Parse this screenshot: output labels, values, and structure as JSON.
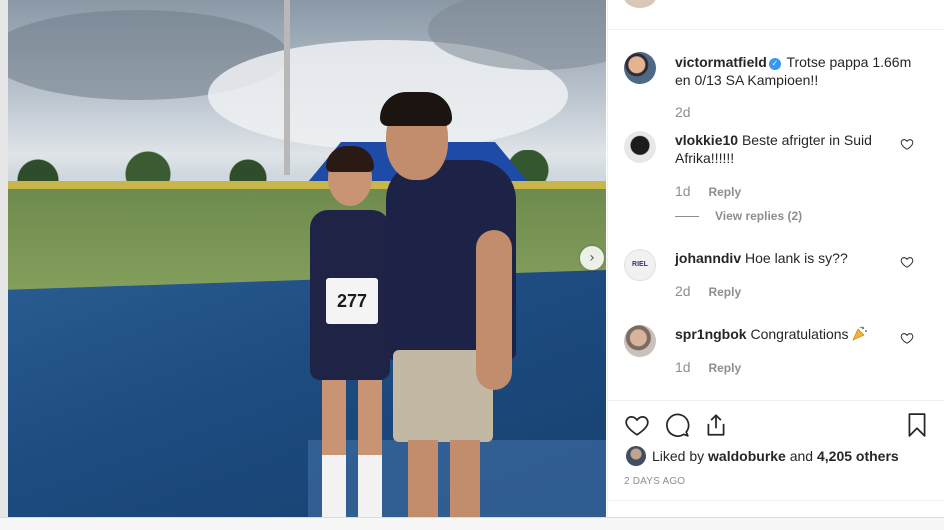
{
  "post": {
    "caption_user": "victormatfield",
    "caption_text": "Trotse pappa 1.66m en 0/13 SA Kampioen!!",
    "caption_age": "2d",
    "likes_prefix": "Liked by",
    "likes_user": "waldoburke",
    "likes_and": "and",
    "likes_others": "4,205 others",
    "posted_ago": "2 DAYS AGO",
    "photo_bib_number": "277"
  },
  "comments": [
    {
      "user": "vlokkie10",
      "text": "Beste afrigter in Suid Afrika!!!!!!",
      "age": "1d",
      "reply": "Reply",
      "view_replies": "View replies (2)"
    },
    {
      "user": "johanndiv",
      "text": "Hoe lank is sy??",
      "age": "2d",
      "reply": "Reply"
    },
    {
      "user": "spr1ngbok",
      "text": "Congratulations",
      "age": "1d",
      "reply": "Reply"
    }
  ],
  "icons": {
    "next": "chevron-right-icon",
    "verified": "verified-badge-icon",
    "like": "heart-icon",
    "comment": "comment-icon",
    "share": "share-icon",
    "save": "bookmark-icon",
    "emoji": "party-popper-icon"
  },
  "colors": {
    "link": "#262626",
    "muted": "#8e8e8e",
    "verified": "#3897f0"
  }
}
